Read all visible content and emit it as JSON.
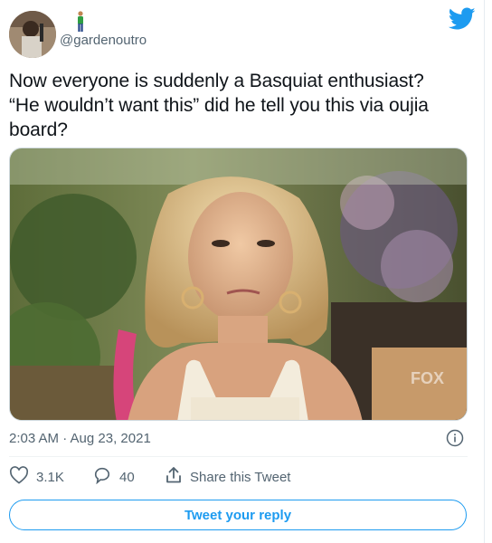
{
  "user": {
    "handle": "@gardenoutro",
    "emoji_name": "person-standing-icon"
  },
  "brand": {
    "icon": "twitter-bird-icon",
    "color": "#1d9bf0"
  },
  "tweet": {
    "line1": "Now everyone is suddenly a Basquiat enthusiast?",
    "line2": "“He wouldn’t want this” did he tell you this via oujia",
    "line3": "board?",
    "timestamp": "2:03 AM · Aug 23, 2021"
  },
  "media": {
    "watermark": "FOX"
  },
  "actions": {
    "like_count": "3.1K",
    "reply_count": "40",
    "share_label": "Share this Tweet"
  },
  "reply_button": {
    "label": "Tweet your reply"
  }
}
